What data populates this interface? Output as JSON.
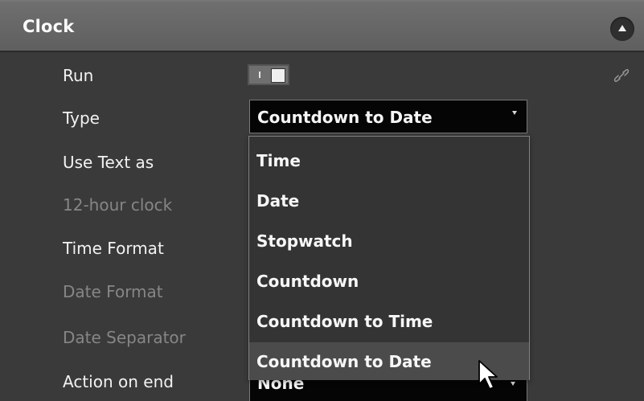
{
  "section": {
    "title": "Clock"
  },
  "rows": {
    "run": "Run",
    "type": "Type",
    "use_text_as": "Use Text as",
    "twelve_hour_clock": "12-hour clock",
    "time_format": "Time Format",
    "date_format": "Date Format",
    "date_separator": "Date Separator",
    "action_on_end": "Action on end"
  },
  "type_select": {
    "value": "Countdown to Date"
  },
  "action_select": {
    "value": "None"
  },
  "dropdown": {
    "options": [
      "Time",
      "Date",
      "Stopwatch",
      "Countdown",
      "Countdown to Time",
      "Countdown to Date"
    ],
    "selected": "Countdown to Date"
  },
  "icons": {
    "collapse": "chevron-up-icon",
    "link": "link-icon",
    "cursor": "mouse-pointer-icon"
  },
  "colors": {
    "panel_background": "#3a3a3a",
    "header_background": "#666666",
    "select_background": "#050505",
    "dropdown_background": "#343434",
    "selected_item_background": "#4b4b4b",
    "disabled_text": "#868686"
  }
}
